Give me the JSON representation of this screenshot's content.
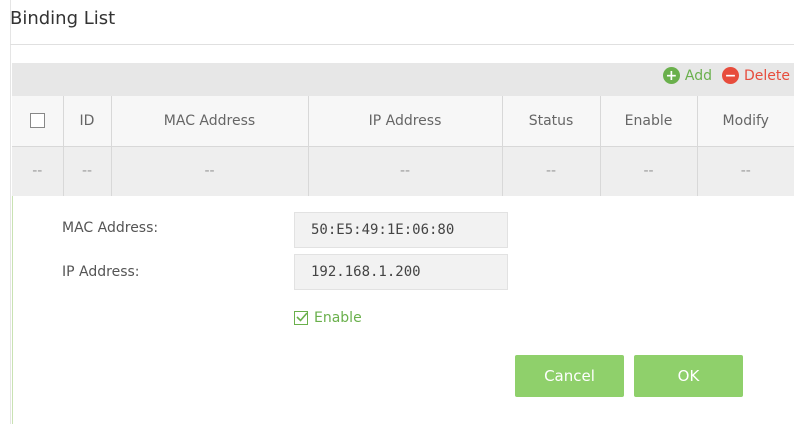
{
  "page": {
    "title": "Binding List"
  },
  "toolbar": {
    "add_label": "Add",
    "delete_label": "Delete"
  },
  "table": {
    "headers": [
      "ID",
      "MAC Address",
      "IP Address",
      "Status",
      "Enable",
      "Modify"
    ],
    "rows": [
      [
        "--",
        "--",
        "--",
        "--",
        "--",
        "--",
        "--"
      ]
    ]
  },
  "form": {
    "mac_label": "MAC Address:",
    "mac_value": "50:E5:49:1E:06:80",
    "ip_label": "IP Address:",
    "ip_value": "192.168.1.200",
    "enable_label": "Enable",
    "enable_checked": true,
    "cancel_label": "Cancel",
    "ok_label": "OK"
  },
  "colors": {
    "accent_green": "#6ab04c",
    "button_green": "#8fd06b",
    "delete_red": "#e74c3c"
  }
}
